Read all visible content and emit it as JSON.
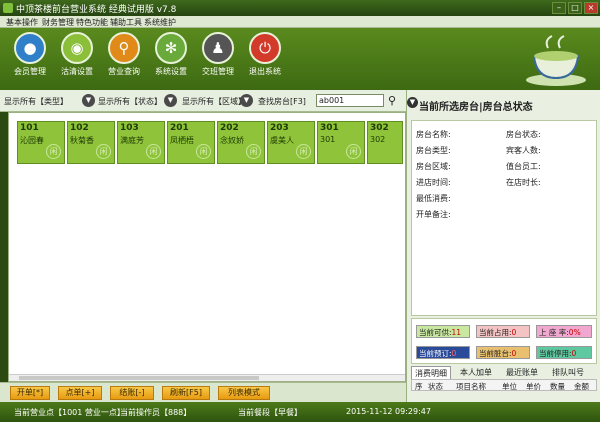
{
  "window": {
    "title": "中顶茶楼前台营业系统 经典试用版 v7.8",
    "min": "–",
    "max": "□",
    "close": "×"
  },
  "menu": [
    "基本操作",
    "财务管理",
    "特色功能",
    "辅助工具",
    "系统维护"
  ],
  "toolbar": [
    {
      "label": "会员管理",
      "icon": "member-icon",
      "color": "#2f7fc9",
      "glyph": "●"
    },
    {
      "label": "沽清设置",
      "icon": "plate-icon",
      "color": "#8bbf3a",
      "glyph": "◉"
    },
    {
      "label": "营业查询",
      "icon": "search-icon",
      "color": "#e08a1a",
      "glyph": "⚲"
    },
    {
      "label": "系统设置",
      "icon": "gear-icon",
      "color": "#6aaa3a",
      "glyph": "✻"
    },
    {
      "label": "交班管理",
      "icon": "handover-icon",
      "color": "#555555",
      "glyph": "♟"
    },
    {
      "label": "退出系统",
      "icon": "power-icon",
      "color": "#d23a2a",
      "glyph": "⏻"
    }
  ],
  "filters": {
    "type_label": "显示所有【类型】",
    "status_label": "显示所有【状态】",
    "area_label": "显示所有【区域】",
    "find_label": "查找房台[F3]",
    "find_value": "ab001"
  },
  "rooms": [
    {
      "number": "101",
      "name": "沁园春",
      "status": "闲"
    },
    {
      "number": "102",
      "name": "秋菊香",
      "status": "闲"
    },
    {
      "number": "103",
      "name": "满庭芳",
      "status": "闲"
    },
    {
      "number": "201",
      "name": "凤栖梧",
      "status": "闲"
    },
    {
      "number": "202",
      "name": "念奴娇",
      "status": "闲"
    },
    {
      "number": "203",
      "name": "虞美人",
      "status": "闲"
    },
    {
      "number": "301",
      "name": "301",
      "status": "闲"
    },
    {
      "number": "302",
      "name": "302",
      "status": "闲"
    }
  ],
  "actions": [
    "开单[*]",
    "点单[+]",
    "结账[-]",
    "刷新[F5]",
    "列表模式"
  ],
  "right_panel": {
    "title": "当前所选房台|房台总状态",
    "fields_left": [
      "房台名称:",
      "房台类型:",
      "房台区域:",
      "进店时间:",
      "最低消费:",
      "开单备注:"
    ],
    "fields_right": [
      "房台状态:",
      "宾客人数:",
      "值台员工:",
      "在店时长:"
    ]
  },
  "stats": [
    {
      "label": "当前可供:",
      "value": "11",
      "bg": "#c8e8a0"
    },
    {
      "label": "当前占用:",
      "value": "0",
      "bg": "#f4c4c4"
    },
    {
      "label": "上 座 率:",
      "value": "0%",
      "bg": "#f0a8d0"
    },
    {
      "label": "当前预订:",
      "value": "0",
      "bg": "#2a4a9a"
    },
    {
      "label": "当前脏台:",
      "value": "0",
      "bg": "#e8c070"
    },
    {
      "label": "当前停用:",
      "value": "0",
      "bg": "#5ec8a0"
    }
  ],
  "tabs": [
    "消费明细",
    "本人加单",
    "最近账单",
    "排队叫号"
  ],
  "table_headers": [
    "序",
    "状态",
    "项目名称",
    "单位",
    "单价",
    "数量",
    "金额"
  ],
  "statusbar": {
    "point": "当前营业点【1001 营业一点】",
    "operator": "当前操作员【888】",
    "meal": "当前餐段【早餐】",
    "datetime": "2015-11-12 09:29:47"
  }
}
